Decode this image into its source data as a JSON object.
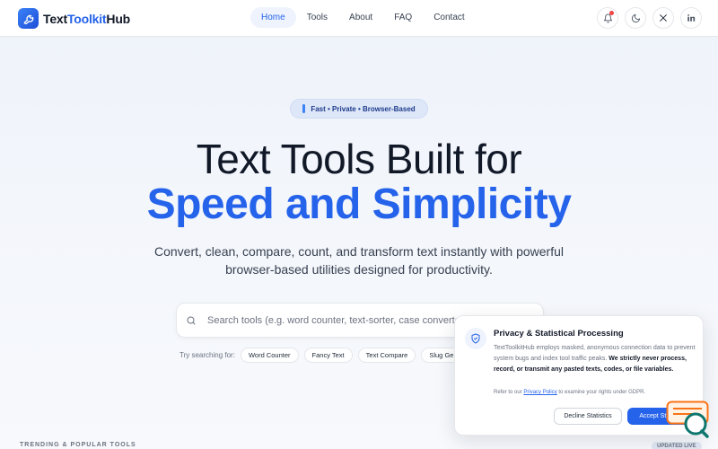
{
  "header": {
    "logo_text_a": "Text",
    "logo_text_b": "Toolkit",
    "logo_text_c": "Hub",
    "nav": [
      {
        "label": "Home"
      },
      {
        "label": "Tools"
      },
      {
        "label": "About"
      },
      {
        "label": "FAQ"
      },
      {
        "label": "Contact"
      }
    ]
  },
  "hero": {
    "badge": "Fast • Private • Browser-Based",
    "title_line1": "Text Tools Built for",
    "title_line2": "Speed and Simplicity",
    "subtitle": "Convert, clean, compare, count, and transform text instantly with powerful browser-based utilities designed for productivity."
  },
  "search": {
    "placeholder": "Search tools (e.g. word counter, text-sorter, case converter...)",
    "try_label": "Try searching for:",
    "chips": [
      "Word Counter",
      "Fancy Text",
      "Text Compare",
      "Slug Gen"
    ]
  },
  "bottom": {
    "trending": "TRENDING & POPULAR TOOLS",
    "updated": "UPDATED LIVE"
  },
  "privacy": {
    "title": "Privacy & Statistical Processing",
    "body_plain": "TextToolkitHub employs masked, anonymous connection data to prevent system bugs and index tool traffic peaks.",
    "body_bold": "We strictly never process, record, or transmit any pasted texts, codes, or file variables.",
    "note_pre": "Refer to our",
    "note_link": "Privacy Policy",
    "note_post": "to examine your rights under GDPR.",
    "decline": "Decline Statistics",
    "accept": "Accept Statistics"
  },
  "colors": {
    "accent": "#2563eb",
    "notification_dot": "#ef4444",
    "chat_widget": "#f97316"
  }
}
